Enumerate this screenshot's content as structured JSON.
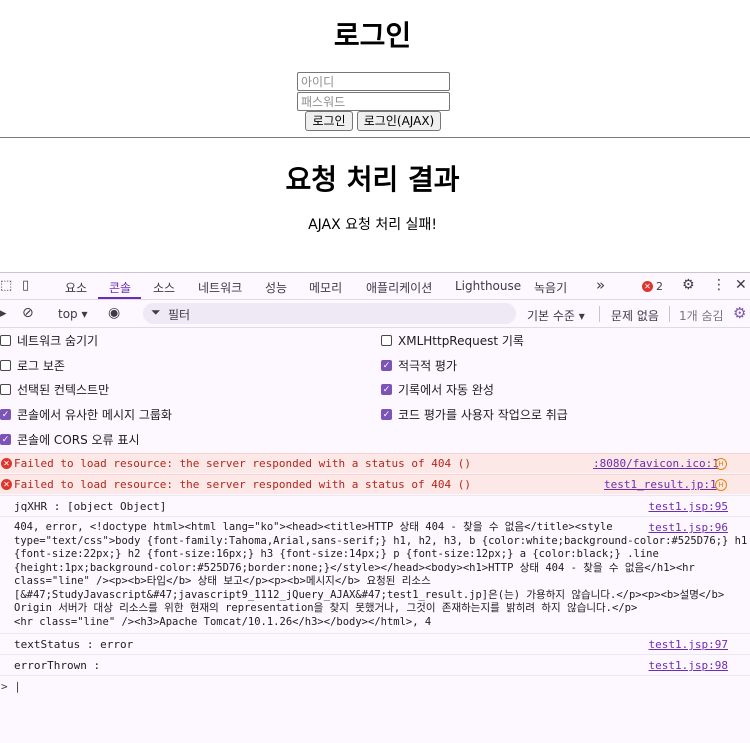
{
  "page": {
    "login_title": "로그인",
    "id_placeholder": "아이디",
    "pw_placeholder": "패스워드",
    "login_button": "로그인",
    "ajax_login_button": "로그인(AJAX)",
    "result_title": "요청 처리 결과",
    "result_message": "AJAX 요청 처리 실패!"
  },
  "devtools": {
    "tabs": [
      "요소",
      "콘솔",
      "소스",
      "네트워크",
      "성능",
      "메모리",
      "애플리케이션",
      "Lighthouse",
      "녹음기"
    ],
    "active_tab": "콘솔",
    "more_tabs": "»",
    "error_count": "2",
    "toolbar": {
      "context": "top ▾",
      "filter_placeholder": "필터",
      "levels": "기본 수준 ▾",
      "issues": "문제 없음",
      "hidden": "1개 숨김"
    },
    "settings_left": [
      {
        "label": "네트워크 숨기기",
        "checked": false
      },
      {
        "label": "로그 보존",
        "checked": false
      },
      {
        "label": "선택된 컨텍스트만",
        "checked": false
      },
      {
        "label": "콘솔에서 유사한 메시지 그룹화",
        "checked": true
      },
      {
        "label": "콘솔에 CORS 오류 표시",
        "checked": true
      }
    ],
    "settings_right": [
      {
        "label": "XMLHttpRequest 기록",
        "checked": false
      },
      {
        "label": "적극적 평가",
        "checked": true
      },
      {
        "label": "기록에서 자동 완성",
        "checked": true
      },
      {
        "label": "코드 평가를 사용자 작업으로 취급",
        "checked": true
      }
    ],
    "errors": [
      {
        "message": "Failed to load resource: the server responded with a status of 404 ()",
        "source": ":8080/favicon.ico:1"
      },
      {
        "message": "Failed to load resource: the server responded with a status of 404 ()",
        "source": "test1_result.jp:1"
      }
    ],
    "logs": [
      {
        "message": "jqXHR : [object Object]",
        "source": "test1.jsp:95"
      },
      {
        "message": "404, error, <!doctype html><html lang=\"ko\"><head><title>HTTP 상태 404 - 찾을 수 없음</title><style\ntype=\"text/css\">body {font-family:Tahoma,Arial,sans-serif;} h1, h2, h3, b {color:white;background-color:#525D76;} h1\n{font-size:22px;} h2 {font-size:16px;} h3 {font-size:14px;} p {font-size:12px;} a {color:black;} .line\n{height:1px;background-color:#525D76;border:none;}</style></head><body><h1>HTTP 상태 404 - 찾을 수 없음</h1><hr\nclass=\"line\" /><p><b>타입</b> 상태 보고</p><p><b>메시지</b> 요청된 리소스\n[&#47;StudyJavascript&#47;javascript9_1112_jQuery_AJAX&#47;test1_result.jp]은(는) 가용하지 않습니다.</p><p><b>설명</b>\nOrigin 서버가 대상 리소스를 위한 현재의 representation을 찾지 못했거나, 그것이 존재하는지를 밝히려 하지 않습니다.</p>\n<hr class=\"line\" /><h3>Apache Tomcat/10.1.26</h3></body></html>, 4",
        "source": "test1.jsp:96"
      },
      {
        "message": "textStatus : error",
        "source": "test1.jsp:97"
      },
      {
        "message": "errorThrown :",
        "source": "test1.jsp:98"
      }
    ],
    "prompt": "> |"
  }
}
